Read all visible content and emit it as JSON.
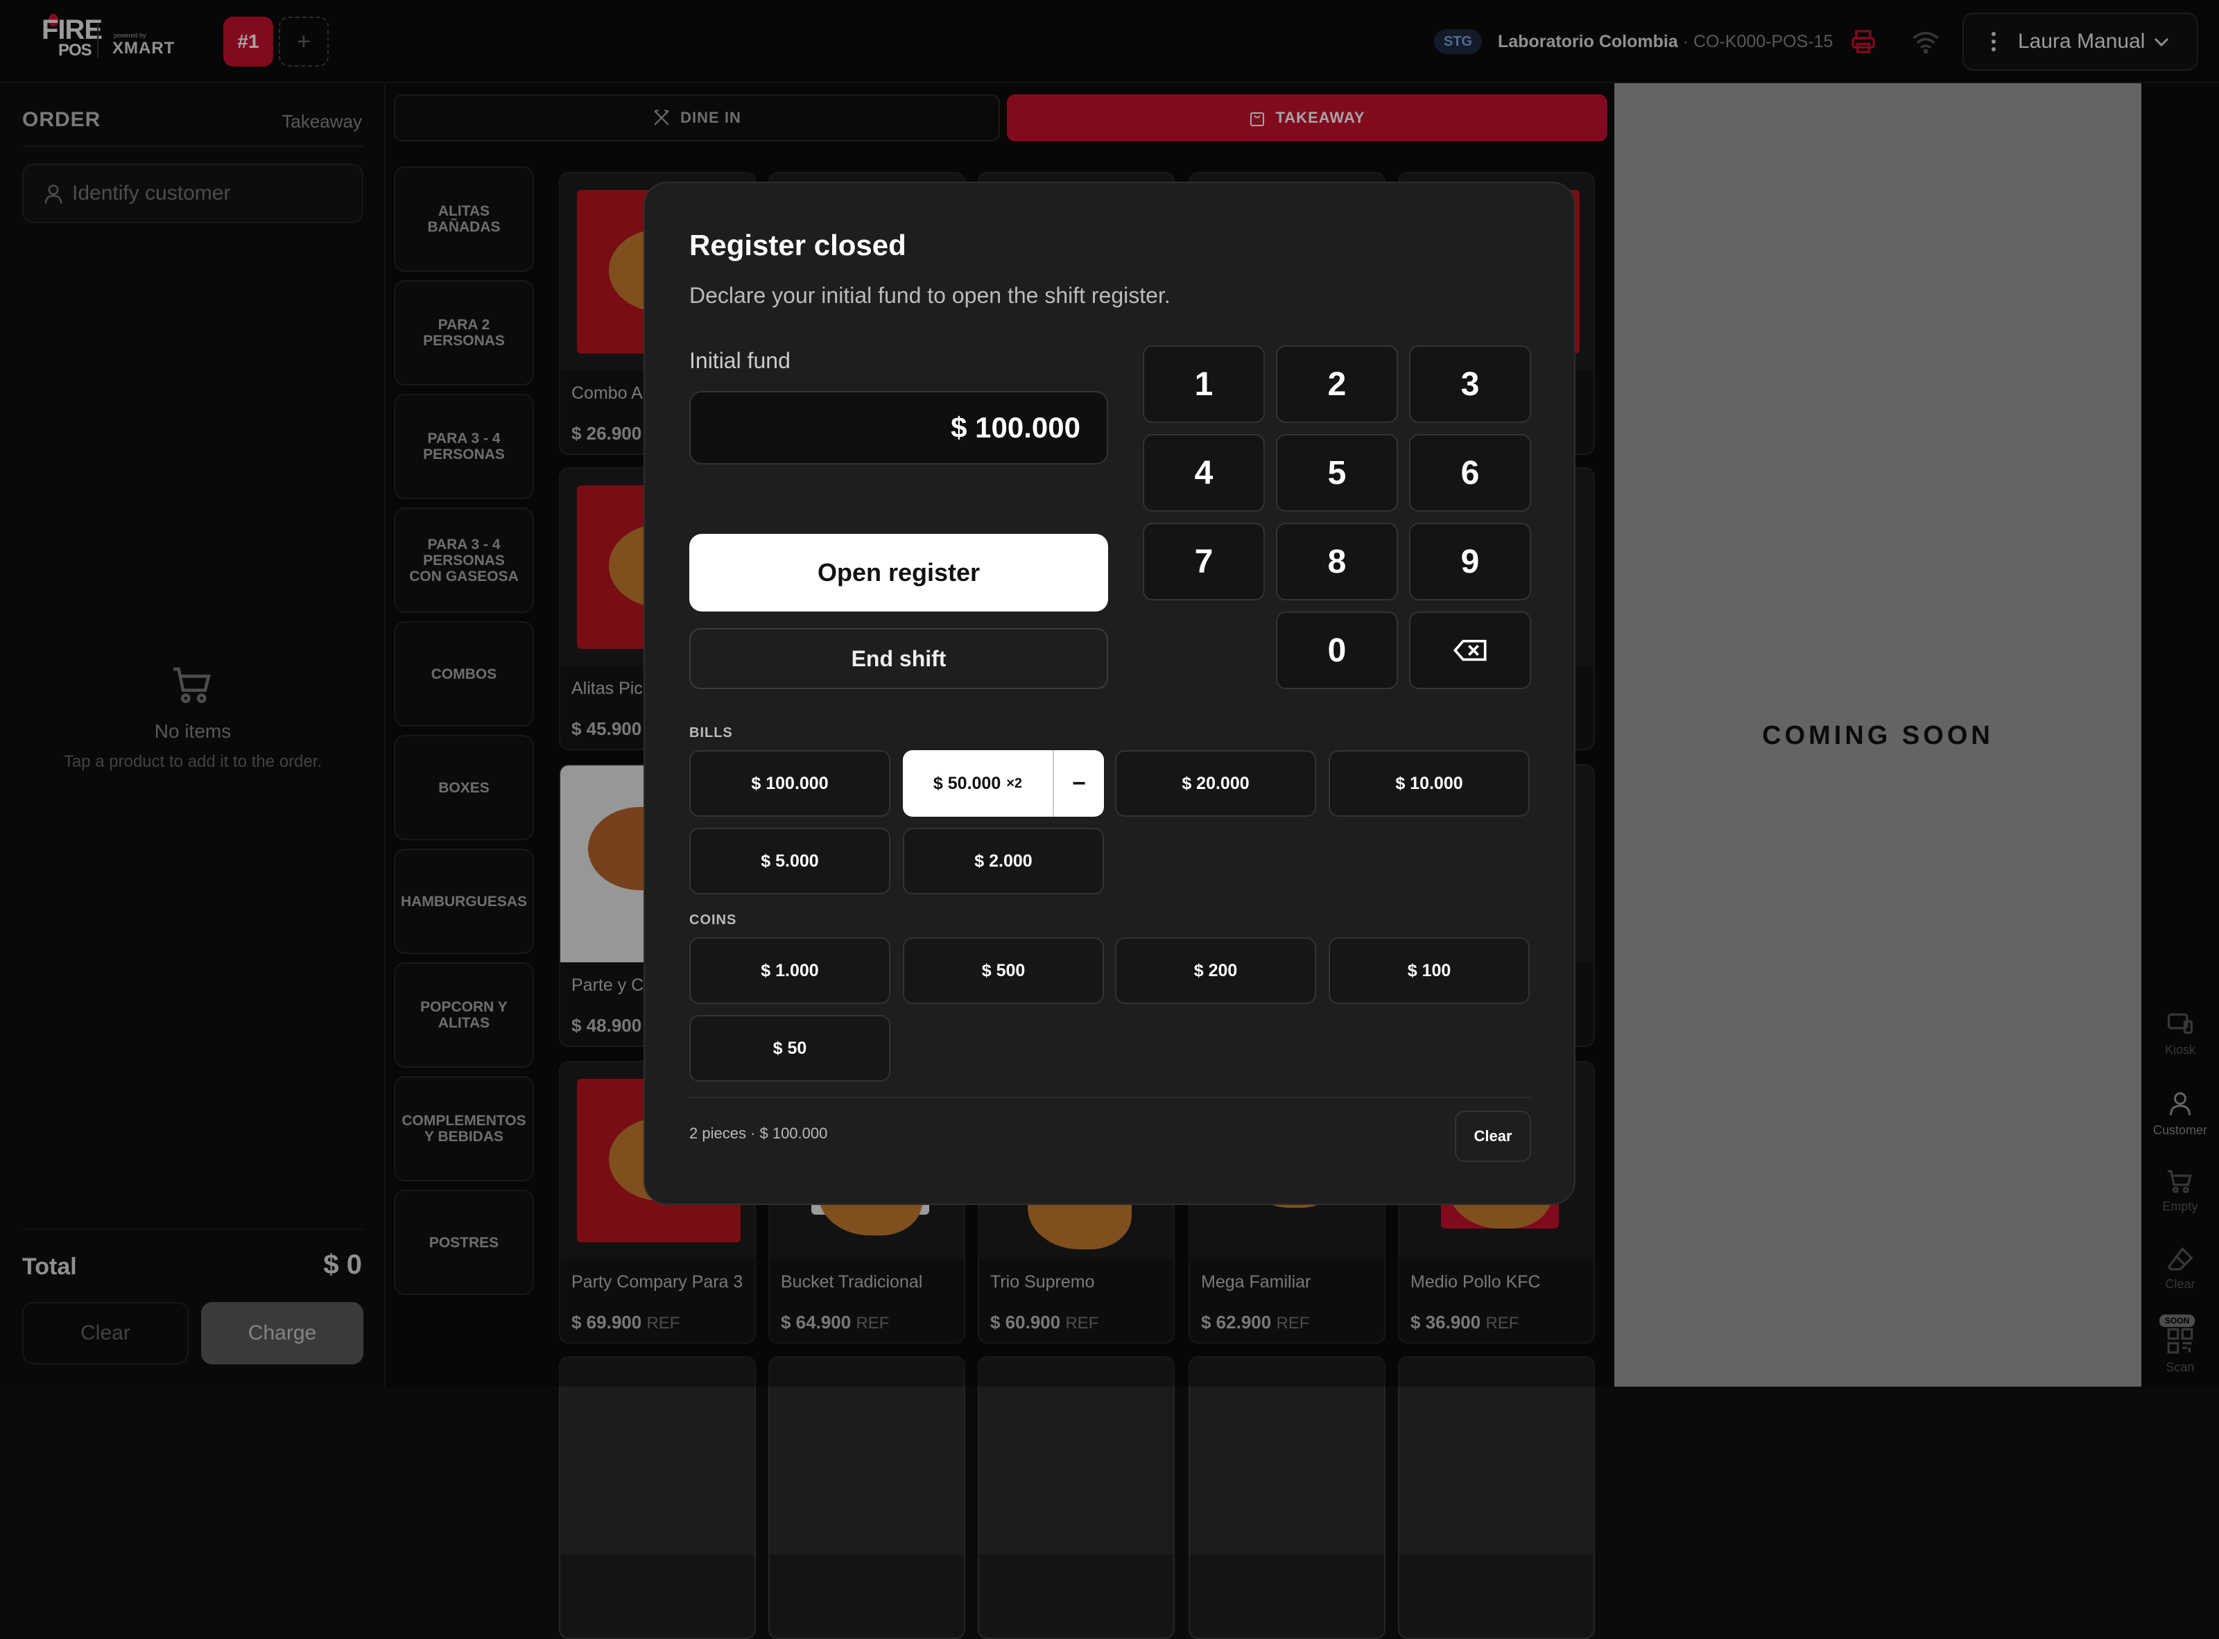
{
  "header": {
    "logo_main": "FIRE",
    "logo_sub": "POS",
    "powered_by": "powered by",
    "partner": "XMART",
    "active_tab": "#1",
    "add_tab": "+",
    "env_badge": "STG",
    "store_name": "Laboratorio Colombia",
    "store_code": " · CO-K000-POS-15",
    "user_name": "Laura Manual"
  },
  "order": {
    "title": "ORDER",
    "mode": "Takeaway",
    "customer_placeholder": "Identify customer",
    "empty_title": "No items",
    "empty_hint": "Tap a product to add it to the order.",
    "total_label": "Total",
    "total_value": "$ 0",
    "clear_label": "Clear",
    "charge_label": "Charge"
  },
  "modes": {
    "dine_in": "DINE IN",
    "takeaway": "TAKEAWAY"
  },
  "categories": [
    "ALITAS BAÑADAS",
    "PARA 2 PERSONAS",
    "PARA 3 - 4 PERSONAS",
    "PARA 3 - 4 PERSONAS CON GASEOSA",
    "COMBOS",
    "BOXES",
    "HAMBURGUESAS",
    "POPCORN Y ALITAS",
    "COMPLEMENTOS Y BEBIDAS",
    "POSTRES"
  ],
  "products": {
    "row1": [
      {
        "name": "Combo A Picantes",
        "price": "$ 26.900"
      }
    ],
    "row2": [
      {
        "name": "Alitas Pic Bañadas",
        "price": "$ 45.900"
      }
    ],
    "row3": [
      {
        "name": "Parte y C Presas",
        "price": "$ 48.900"
      }
    ],
    "row4": [
      {
        "name": "Party Compary Para 3",
        "price": "$ 69.900",
        "ref": "REF"
      },
      {
        "name": "Bucket Tradicional",
        "price": "$ 64.900",
        "ref": "REF"
      },
      {
        "name": "Trio Supremo",
        "price": "$ 60.900",
        "ref": "REF"
      },
      {
        "name": "Mega Familiar",
        "price": "$ 62.900",
        "ref": "REF"
      },
      {
        "name": "Medio Pollo KFC",
        "price": "$ 36.900",
        "ref": "REF"
      }
    ]
  },
  "coming_soon": "COMING SOON",
  "rail": {
    "kiosk": "Kiosk",
    "customer": "Customer",
    "empty": "Empty",
    "clear": "Clear",
    "scan": "Scan",
    "soon_badge": "SOON"
  },
  "modal": {
    "title": "Register closed",
    "subtitle": "Declare your initial fund to open the shift register.",
    "fund_label": "Initial fund",
    "fund_value": "$ 100.000",
    "open_label": "Open register",
    "end_label": "End shift",
    "keys": [
      "1",
      "2",
      "3",
      "4",
      "5",
      "6",
      "7",
      "8",
      "9",
      "0"
    ],
    "bills_label": "BILLS",
    "bills": [
      "$ 100.000",
      "$ 50.000",
      "$ 20.000",
      "$ 10.000",
      "$ 5.000",
      "$ 2.000"
    ],
    "bill_selected_count": "×2",
    "minus": "−",
    "coins_label": "COINS",
    "coins": [
      "$ 1.000",
      "$ 500",
      "$ 200",
      "$ 100",
      "$ 50"
    ],
    "summary": "2 pieces · $ 100.000",
    "clear_label": "Clear"
  },
  "colors": {
    "accent": "#c8102e",
    "background": "#0b0b0b",
    "modal": "#1e1e1e"
  }
}
